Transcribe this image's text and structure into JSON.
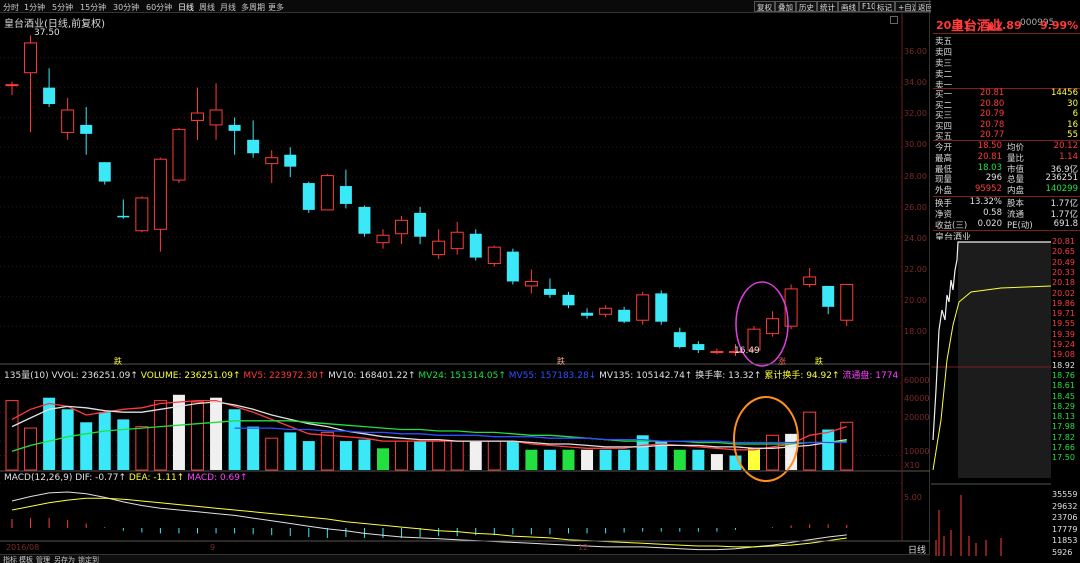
{
  "stock": {
    "name": "皇台酒业",
    "code": "000995"
  },
  "periods": [
    {
      "label": "分时"
    },
    {
      "label": "1分钟"
    },
    {
      "label": "5分钟"
    },
    {
      "label": "15分钟"
    },
    {
      "label": "30分钟"
    },
    {
      "label": "60分钟"
    },
    {
      "label": "日线",
      "active": true
    },
    {
      "label": "周线"
    },
    {
      "label": "月线"
    },
    {
      "label": "多周期"
    },
    {
      "label": "更多"
    }
  ],
  "tools": [
    "复权",
    "叠加",
    "历史",
    "统计",
    "画线",
    "F10",
    "标记",
    "+自选",
    "返回"
  ],
  "chart_title": "皇台酒业(日线,前复权)",
  "price_axis_labels": [
    "36.00",
    "34.00",
    "32.00",
    "30.00",
    "28.00",
    "26.00",
    "24.00",
    "22.00",
    "20.00",
    "18.00"
  ],
  "high_label": "37.50",
  "low_label": "16.49",
  "event_markers": [
    {
      "text": "跌",
      "color": "#ffff3a"
    },
    {
      "text": "跌",
      "color": "#ffb080"
    },
    {
      "text": "涨",
      "color": "#ff6060"
    },
    {
      "text": "跌",
      "color": "#ffff3a"
    }
  ],
  "indicator_line": [
    {
      "text": "135量(10) VVOL: 236251.09↑",
      "color": "#e0e0e0"
    },
    {
      "text": "VOLUME: 236251.09↑",
      "color": "#ffff3a"
    },
    {
      "text": "MV5: 223972.30↑",
      "color": "#ff3b3b"
    },
    {
      "text": "MV10: 168401.22↑",
      "color": "#e0e0e0"
    },
    {
      "text": "MV24: 151314.05↑",
      "color": "#22e040"
    },
    {
      "text": "MV55: 157183.28↓",
      "color": "#3050ff"
    },
    {
      "text": "MV135: 105142.74↑",
      "color": "#e0e0e0"
    },
    {
      "text": "换手率: 13.32↑",
      "color": "#e0e0e0"
    },
    {
      "text": "累计换手: 94.92↑",
      "color": "#ffff3a"
    },
    {
      "text": "流通盘: 1774",
      "color": "#ff40ff"
    }
  ],
  "volume_axis_labels": [
    "60000",
    "40000",
    "20000",
    "10000"
  ],
  "volume_unit": "X10",
  "macd_line": [
    {
      "text": "MACD(12,26,9) DIF: -0.77↑",
      "color": "#e0e0e0"
    },
    {
      "text": "DEA: -1.11↑",
      "color": "#ffff3a"
    },
    {
      "text": "MACD: 0.69↑",
      "color": "#ff40ff"
    }
  ],
  "macd_axis_label": "5.00",
  "date_axis": {
    "left": "2016/08",
    "mid1": "9",
    "mid2": "12"
  },
  "bottom_tabs": [
    "指标",
    "模板",
    "管理",
    "另存为",
    "锁定到"
  ],
  "quote": {
    "price": "20.81",
    "change": "▲1.89",
    "change_pct": "9.99%",
    "asks": [
      "卖五",
      "卖四",
      "卖三",
      "卖二",
      "卖一"
    ],
    "bids": [
      {
        "label": "买一",
        "price": "20.81",
        "vol": "14456"
      },
      {
        "label": "买二",
        "price": "20.80",
        "vol": "30"
      },
      {
        "label": "买三",
        "price": "20.79",
        "vol": "6"
      },
      {
        "label": "买四",
        "price": "20.78",
        "vol": "16"
      },
      {
        "label": "买五",
        "price": "20.77",
        "vol": "55"
      }
    ],
    "stats": [
      {
        "l1": "今开",
        "v1": "18.50",
        "c1": "#ff3b3b",
        "l2": "均价",
        "v2": "20.12",
        "c2": "#ff3b3b"
      },
      {
        "l1": "最高",
        "v1": "20.81",
        "c1": "#ff3b3b",
        "l2": "量比",
        "v2": "1.14",
        "c2": "#ff3b3b"
      },
      {
        "l1": "最低",
        "v1": "18.03",
        "c1": "#22e040",
        "l2": "市值",
        "v2": "36.9亿",
        "c2": "#e0e0e0"
      },
      {
        "l1": "现量",
        "v1": "296",
        "c1": "#e0e0e0",
        "l2": "总量",
        "v2": "236251",
        "c2": "#e0e0e0"
      },
      {
        "l1": "外盘",
        "v1": "95952",
        "c1": "#ff3b3b",
        "l2": "内盘",
        "v2": "140299",
        "c2": "#22e040"
      }
    ],
    "stats2": [
      {
        "l1": "换手",
        "v1": "13.32%",
        "c1": "#e0e0e0",
        "l2": "股本",
        "v2": "1.77亿",
        "c2": "#e0e0e0"
      },
      {
        "l1": "净资",
        "v1": "0.58",
        "c1": "#e0e0e0",
        "l2": "流通",
        "v2": "1.77亿",
        "c2": "#e0e0e0"
      },
      {
        "l1": "收益(三)",
        "v1": "0.020",
        "c1": "#e0e0e0",
        "l2": "PE(动)",
        "v2": "691.8",
        "c2": "#e0e0e0"
      }
    ]
  },
  "intraday": {
    "title": "皇台酒业",
    "price_labels": [
      {
        "text": "20.81",
        "color": "#ff3b3b"
      },
      {
        "text": "20.65",
        "color": "#ff3b3b"
      },
      {
        "text": "20.49",
        "color": "#ff3b3b"
      },
      {
        "text": "20.33",
        "color": "#ff3b3b"
      },
      {
        "text": "20.18",
        "color": "#ff3b3b"
      },
      {
        "text": "20.02",
        "color": "#ff3b3b"
      },
      {
        "text": "19.86",
        "color": "#ff3b3b"
      },
      {
        "text": "19.71",
        "color": "#ff3b3b"
      },
      {
        "text": "19.55",
        "color": "#ff3b3b"
      },
      {
        "text": "19.39",
        "color": "#ff3b3b"
      },
      {
        "text": "19.24",
        "color": "#ff3b3b"
      },
      {
        "text": "19.08",
        "color": "#ff3b3b"
      },
      {
        "text": "18.92",
        "color": "#e0e0e0"
      },
      {
        "text": "18.76",
        "color": "#22e040"
      },
      {
        "text": "18.61",
        "color": "#22e040"
      },
      {
        "text": "18.45",
        "color": "#22e040"
      },
      {
        "text": "18.29",
        "color": "#22e040"
      },
      {
        "text": "18.13",
        "color": "#22e040"
      },
      {
        "text": "17.98",
        "color": "#22e040"
      },
      {
        "text": "17.82",
        "color": "#22e040"
      },
      {
        "text": "17.66",
        "color": "#22e040"
      },
      {
        "text": "17.50",
        "color": "#22e040"
      }
    ],
    "vol_labels": [
      "35559",
      "29632",
      "23706",
      "17779",
      "11853",
      "5926"
    ],
    "footer": "日线"
  },
  "chart_data": {
    "type": "candlestick",
    "title": "皇台酒业(日线,前复权)",
    "ylim": [
      16,
      38
    ],
    "candles": [
      {
        "o": 34.2,
        "c": 34.2,
        "h": 34.4,
        "l": 33.5
      },
      {
        "o": 35.0,
        "c": 37.0,
        "h": 37.5,
        "l": 31.0
      },
      {
        "o": 34.0,
        "c": 32.9,
        "h": 35.3,
        "l": 32.7
      },
      {
        "o": 31.0,
        "c": 32.5,
        "h": 33.3,
        "l": 30.5
      },
      {
        "o": 31.5,
        "c": 30.9,
        "h": 32.7,
        "l": 29.5
      },
      {
        "o": 29.0,
        "c": 27.7,
        "h": 29.0,
        "l": 27.5
      },
      {
        "o": 25.4,
        "c": 25.3,
        "h": 26.5,
        "l": 25.2
      },
      {
        "o": 24.4,
        "c": 26.6,
        "h": 26.7,
        "l": 24.3
      },
      {
        "o": 24.5,
        "c": 29.2,
        "h": 29.3,
        "l": 23.0
      },
      {
        "o": 27.8,
        "c": 31.2,
        "h": 31.3,
        "l": 27.6
      },
      {
        "o": 31.8,
        "c": 32.3,
        "h": 34.0,
        "l": 30.5
      },
      {
        "o": 31.5,
        "c": 32.5,
        "h": 34.3,
        "l": 30.5
      },
      {
        "o": 31.5,
        "c": 31.1,
        "h": 32.0,
        "l": 29.5
      },
      {
        "o": 30.5,
        "c": 29.6,
        "h": 31.8,
        "l": 29.3
      },
      {
        "o": 28.9,
        "c": 29.3,
        "h": 29.8,
        "l": 27.6
      },
      {
        "o": 29.5,
        "c": 28.7,
        "h": 30.0,
        "l": 28.0
      },
      {
        "o": 27.6,
        "c": 25.8,
        "h": 27.7,
        "l": 25.6
      },
      {
        "o": 25.8,
        "c": 28.1,
        "h": 28.2,
        "l": 25.8
      },
      {
        "o": 27.4,
        "c": 26.2,
        "h": 28.5,
        "l": 25.9
      },
      {
        "o": 26.0,
        "c": 24.2,
        "h": 26.1,
        "l": 24.0
      },
      {
        "o": 23.6,
        "c": 24.1,
        "h": 24.5,
        "l": 23.2
      },
      {
        "o": 24.2,
        "c": 25.1,
        "h": 25.4,
        "l": 23.5
      },
      {
        "o": 25.6,
        "c": 24.0,
        "h": 26.0,
        "l": 23.5
      },
      {
        "o": 22.8,
        "c": 23.7,
        "h": 24.5,
        "l": 22.5
      },
      {
        "o": 23.2,
        "c": 24.3,
        "h": 25.0,
        "l": 22.8
      },
      {
        "o": 24.2,
        "c": 22.6,
        "h": 24.5,
        "l": 22.4
      },
      {
        "o": 22.2,
        "c": 23.3,
        "h": 23.4,
        "l": 22.0
      },
      {
        "o": 23.0,
        "c": 21.0,
        "h": 23.2,
        "l": 20.8
      },
      {
        "o": 20.7,
        "c": 21.0,
        "h": 21.8,
        "l": 20.2
      },
      {
        "o": 20.5,
        "c": 20.1,
        "h": 21.2,
        "l": 19.9
      },
      {
        "o": 20.1,
        "c": 19.4,
        "h": 20.3,
        "l": 19.2
      },
      {
        "o": 18.9,
        "c": 18.7,
        "h": 19.2,
        "l": 18.5
      },
      {
        "o": 18.8,
        "c": 19.2,
        "h": 19.4,
        "l": 18.6
      },
      {
        "o": 19.1,
        "c": 18.3,
        "h": 19.3,
        "l": 18.2
      },
      {
        "o": 18.4,
        "c": 20.1,
        "h": 20.3,
        "l": 18.1
      },
      {
        "o": 20.2,
        "c": 18.3,
        "h": 20.4,
        "l": 18.1
      },
      {
        "o": 17.6,
        "c": 16.6,
        "h": 17.9,
        "l": 16.5
      },
      {
        "o": 16.8,
        "c": 16.4,
        "h": 17.0,
        "l": 16.2
      },
      {
        "o": 16.3,
        "c": 16.3,
        "h": 16.5,
        "l": 16.1
      },
      {
        "o": 16.3,
        "c": 16.3,
        "h": 16.8,
        "l": 16.0
      },
      {
        "o": 16.4,
        "c": 17.8,
        "h": 18.0,
        "l": 16.3
      },
      {
        "o": 17.5,
        "c": 18.5,
        "h": 19.0,
        "l": 17.3
      },
      {
        "o": 18.0,
        "c": 20.5,
        "h": 20.8,
        "l": 17.8
      },
      {
        "o": 20.8,
        "c": 21.3,
        "h": 21.9,
        "l": 20.6
      },
      {
        "o": 20.7,
        "c": 19.3,
        "h": 20.7,
        "l": 18.8
      },
      {
        "o": 18.4,
        "c": 20.8,
        "h": 20.8,
        "l": 18.0
      }
    ],
    "volume": {
      "unit": "X10",
      "ylim": [
        0,
        65000
      ],
      "bars": [
        {
          "v": 48000,
          "c": "red"
        },
        {
          "v": 29000,
          "c": "red"
        },
        {
          "v": 50000,
          "c": "cyan"
        },
        {
          "v": 42000,
          "c": "cyan"
        },
        {
          "v": 33000,
          "c": "cyan"
        },
        {
          "v": 40000,
          "c": "cyan"
        },
        {
          "v": 35000,
          "c": "cyan"
        },
        {
          "v": 30000,
          "c": "red"
        },
        {
          "v": 48000,
          "c": "red"
        },
        {
          "v": 52000,
          "c": "white"
        },
        {
          "v": 47000,
          "c": "red"
        },
        {
          "v": 50000,
          "c": "white"
        },
        {
          "v": 42000,
          "c": "cyan"
        },
        {
          "v": 30000,
          "c": "cyan"
        },
        {
          "v": 22000,
          "c": "red"
        },
        {
          "v": 26000,
          "c": "cyan"
        },
        {
          "v": 20000,
          "c": "cyan"
        },
        {
          "v": 26000,
          "c": "red"
        },
        {
          "v": 20000,
          "c": "cyan"
        },
        {
          "v": 21000,
          "c": "cyan"
        },
        {
          "v": 15000,
          "c": "green"
        },
        {
          "v": 20000,
          "c": "red"
        },
        {
          "v": 20000,
          "c": "cyan"
        },
        {
          "v": 20000,
          "c": "red"
        },
        {
          "v": 20000,
          "c": "red"
        },
        {
          "v": 20000,
          "c": "white"
        },
        {
          "v": 20000,
          "c": "red"
        },
        {
          "v": 20000,
          "c": "cyan"
        },
        {
          "v": 14000,
          "c": "green"
        },
        {
          "v": 14000,
          "c": "cyan"
        },
        {
          "v": 14000,
          "c": "green"
        },
        {
          "v": 14000,
          "c": "white"
        },
        {
          "v": 14000,
          "c": "cyan"
        },
        {
          "v": 14000,
          "c": "cyan"
        },
        {
          "v": 24000,
          "c": "cyan"
        },
        {
          "v": 20000,
          "c": "cyan"
        },
        {
          "v": 14000,
          "c": "green"
        },
        {
          "v": 14000,
          "c": "cyan"
        },
        {
          "v": 11000,
          "c": "white"
        },
        {
          "v": 10000,
          "c": "cyan"
        },
        {
          "v": 15000,
          "c": "yellow"
        },
        {
          "v": 24000,
          "c": "red"
        },
        {
          "v": 25000,
          "c": "white"
        },
        {
          "v": 40000,
          "c": "red"
        },
        {
          "v": 28000,
          "c": "cyan"
        },
        {
          "v": 33000,
          "c": "red"
        }
      ]
    },
    "ma_lines": [
      {
        "name": "MV5",
        "color": "#ff3b3b",
        "values": [
          35000,
          42000,
          46000,
          44000,
          38000,
          40000,
          42000,
          43000,
          46000,
          47000,
          48000,
          48000,
          44000,
          40000,
          35000,
          30000,
          25000,
          24000,
          23000,
          22000,
          20000,
          20000,
          20000,
          20000,
          20000,
          20000,
          20000,
          20000,
          18000,
          17000,
          16000,
          15000,
          15000,
          15000,
          17000,
          18000,
          17000,
          16000,
          15000,
          14000,
          14000,
          16000,
          18000,
          24000,
          26000,
          30000
        ]
      },
      {
        "name": "MV10",
        "color": "#e0e0e0",
        "values": [
          30000,
          36000,
          42000,
          44000,
          43000,
          41000,
          40000,
          40000,
          42000,
          44000,
          46000,
          47000,
          45000,
          42000,
          38000,
          35000,
          32000,
          30000,
          27000,
          25000,
          23000,
          22000,
          21000,
          21000,
          20000,
          20000,
          20000,
          20000,
          19000,
          18000,
          18000,
          17000,
          16000,
          16000,
          16000,
          17000,
          17000,
          17000,
          16000,
          16000,
          15000,
          15000,
          16000,
          17000,
          19000,
          21000
        ]
      },
      {
        "name": "MV24",
        "color": "#22e040",
        "values": [
          13000,
          17000,
          20000,
          23000,
          25000,
          27000,
          28000,
          29000,
          30000,
          31000,
          32000,
          33000,
          34000,
          34000,
          34000,
          34000,
          33000,
          32000,
          31000,
          30000,
          29000,
          28000,
          28000,
          27000,
          27000,
          26000,
          26000,
          25000,
          24000,
          24000,
          23000,
          22000,
          21000,
          20000,
          20000,
          20000,
          20000,
          19000,
          19000,
          18000,
          18000,
          18000,
          18000,
          19000,
          19000,
          20000
        ]
      },
      {
        "name": "MV55",
        "color": "#3050ff",
        "values": [
          null,
          null,
          null,
          null,
          null,
          null,
          null,
          null,
          null,
          null,
          null,
          null,
          29000,
          29000,
          29000,
          28000,
          28000,
          27000,
          27000,
          26000,
          26000,
          25000,
          25000,
          24000,
          24000,
          24000,
          23000,
          23000,
          23000,
          22000,
          22000,
          22000,
          21000,
          21000,
          21000,
          20000,
          20000,
          20000,
          20000,
          19000,
          19000,
          19000,
          19000,
          19000,
          19000,
          19000
        ]
      }
    ],
    "macd": {
      "dif": [
        3.0,
        3.5,
        3.9,
        4.0,
        3.8,
        3.4,
        2.9,
        2.5,
        2.2,
        2.0,
        1.8,
        1.6,
        1.4,
        1.1,
        0.8,
        0.5,
        0.2,
        -0.1,
        -0.3,
        -0.6,
        -0.8,
        -1.0,
        -1.1,
        -1.2,
        -1.3,
        -1.4,
        -1.5,
        -1.6,
        -1.7,
        -1.8,
        -1.9,
        -2.0,
        -2.1,
        -2.1,
        -2.1,
        -2.2,
        -2.3,
        -2.4,
        -2.4,
        -2.3,
        -2.1,
        -1.9,
        -1.6,
        -1.3,
        -1.0,
        -0.77
      ],
      "dea": [
        2.0,
        2.4,
        2.8,
        3.1,
        3.3,
        3.3,
        3.2,
        3.0,
        2.8,
        2.6,
        2.4,
        2.2,
        2.0,
        1.8,
        1.6,
        1.4,
        1.2,
        1.0,
        0.7,
        0.5,
        0.3,
        0.1,
        -0.1,
        -0.3,
        -0.4,
        -0.6,
        -0.7,
        -0.9,
        -1.0,
        -1.1,
        -1.3,
        -1.4,
        -1.5,
        -1.6,
        -1.7,
        -1.8,
        -1.9,
        -2.0,
        -2.0,
        -2.1,
        -2.1,
        -2.0,
        -1.9,
        -1.7,
        -1.4,
        -1.11
      ]
    }
  }
}
